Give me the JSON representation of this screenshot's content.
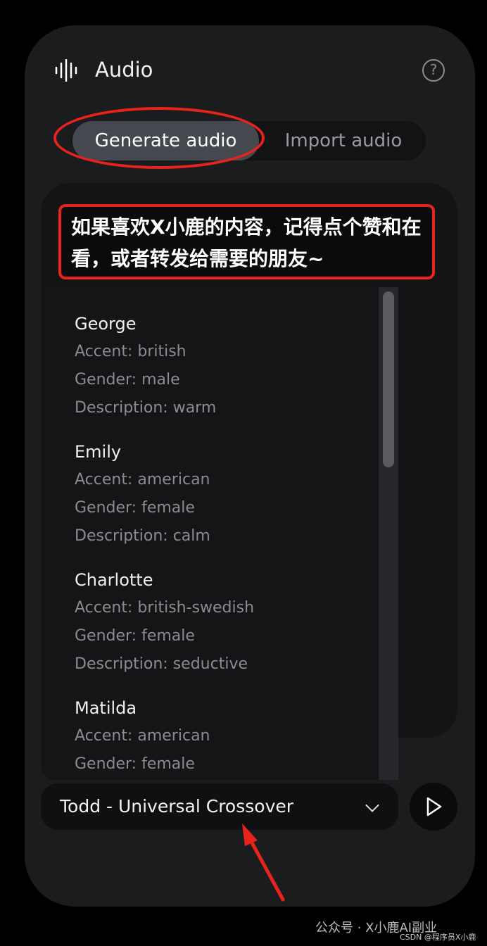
{
  "header": {
    "title": "Audio",
    "icon": "waveform-icon",
    "help_icon": "help-circle-icon"
  },
  "tabs": [
    {
      "label": "Generate audio",
      "active": true
    },
    {
      "label": "Import audio",
      "active": false
    }
  ],
  "notice": {
    "text": "如果喜欢X小鹿的内容，记得点个赞和在看，或者转发给需要的朋友~"
  },
  "voices": [
    {
      "name": "George",
      "accent": "Accent: british",
      "gender": "Gender: male",
      "description": "Description: warm"
    },
    {
      "name": "Emily",
      "accent": "Accent: american",
      "gender": "Gender: female",
      "description": "Description: calm"
    },
    {
      "name": "Charlotte",
      "accent": "Accent: british-swedish",
      "gender": "Gender: female",
      "description": "Description: seductive"
    },
    {
      "name": "Matilda",
      "accent": "Accent: american",
      "gender": "Gender: female",
      "description": ""
    }
  ],
  "voice_select": {
    "value": "Todd - Universal Crossover"
  },
  "play_icon": "play-icon",
  "annotation_color": "#e8231c",
  "watermark": {
    "main": "公众号 · X小鹿AI副业",
    "sub": "CSDN @程序员X小鹿"
  }
}
